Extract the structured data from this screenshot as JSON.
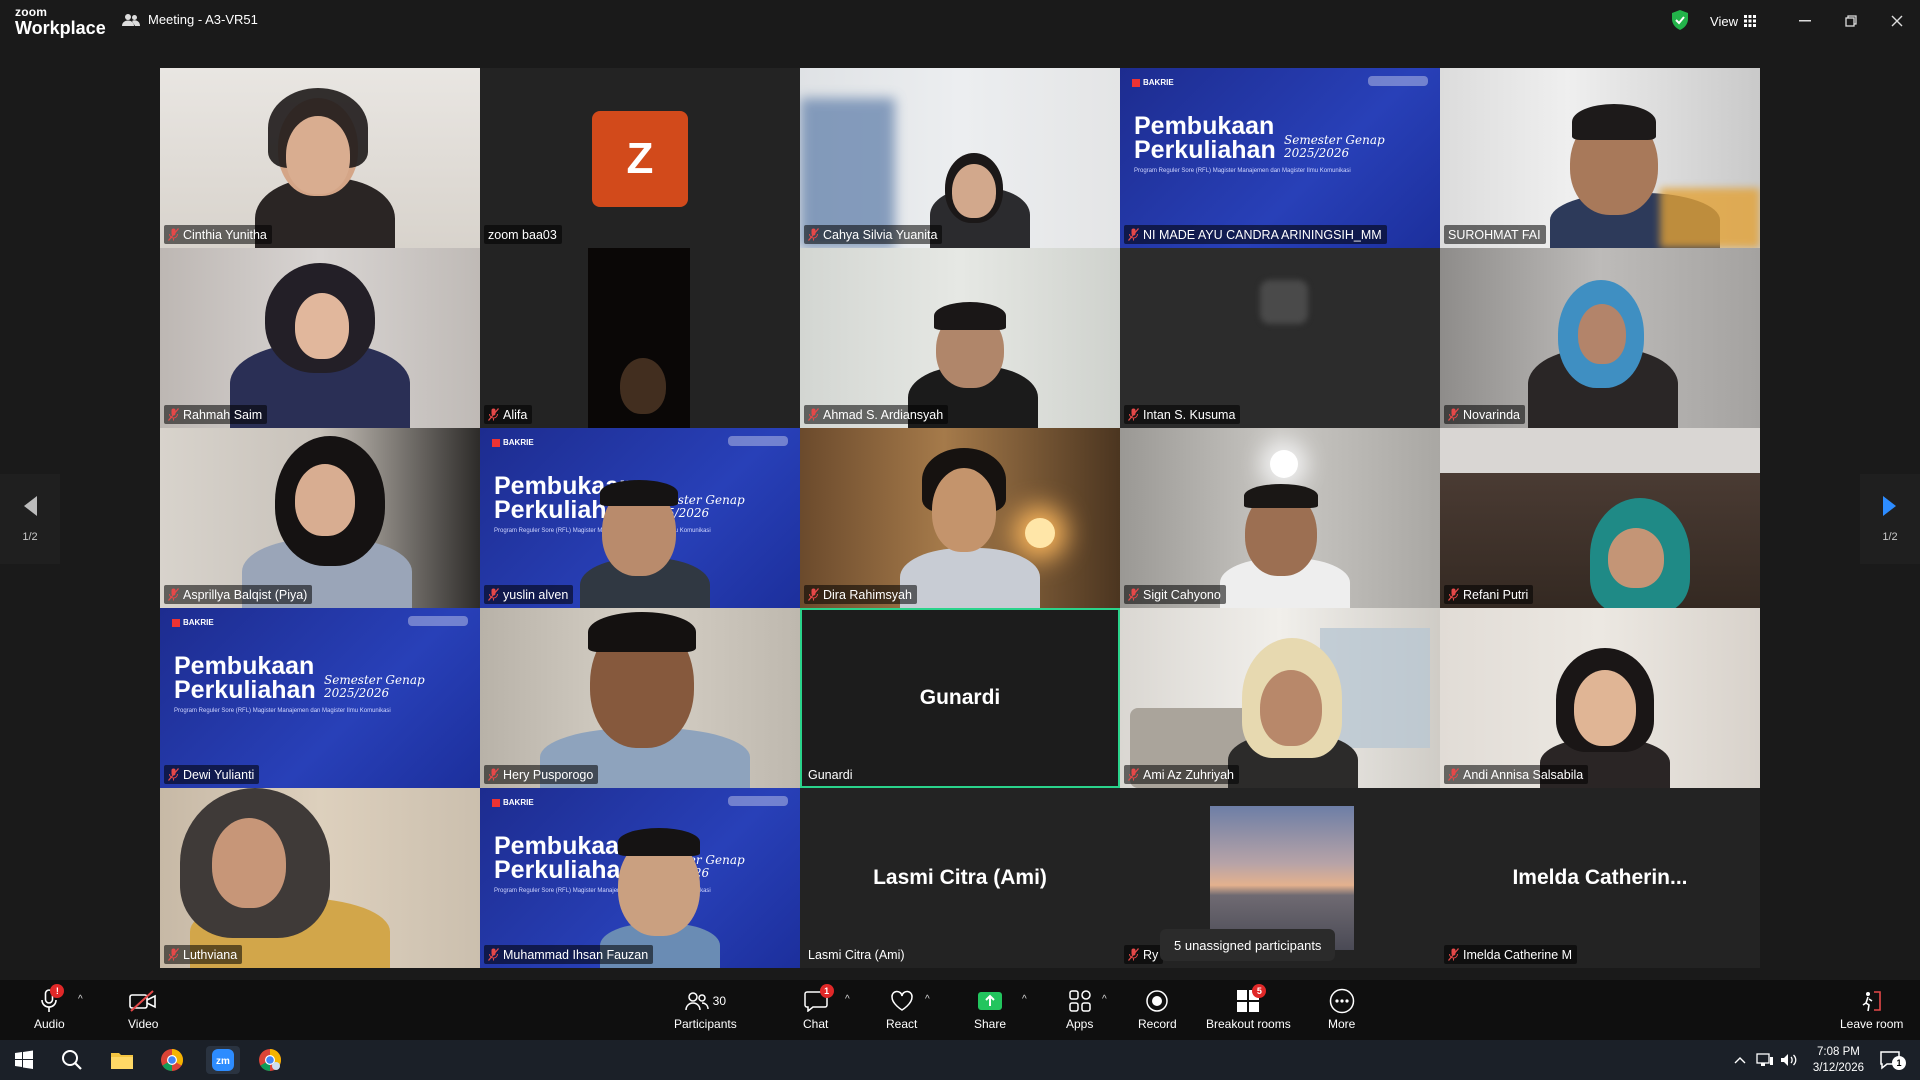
{
  "app": {
    "brand_top": "zoom",
    "brand_bottom": "Workplace",
    "meeting_title": "Meeting - A3-VR51",
    "view_label": "View"
  },
  "slide": {
    "brand": "BAKRIE",
    "title_line1": "Pembukaan",
    "title_line2": "Perkuliahan",
    "semester_line1": "Semester Genap",
    "semester_line2": "2025/2026",
    "subtitle": "Program Reguler Sore (RFL) Magister Manajemen dan Magister Ilmu Komunikasi"
  },
  "participants": [
    {
      "name": "Cinthia Yunitha"
    },
    {
      "name": "zoom baa03",
      "avatar": "Z"
    },
    {
      "name": "Cahya Silvia Yuanita"
    },
    {
      "name": "NI MADE AYU CANDRA ARININGSIH_MM"
    },
    {
      "name": "SUROHMAT FAI"
    },
    {
      "name": "Rahmah Saim"
    },
    {
      "name": "Alifa"
    },
    {
      "name": "Ahmad S. Ardiansyah"
    },
    {
      "name": "Intan S. Kusuma"
    },
    {
      "name": "Novarinda"
    },
    {
      "name": "Asprillya Balqist (Piya)"
    },
    {
      "name": "yuslin alven"
    },
    {
      "name": "Dira Rahimsyah"
    },
    {
      "name": "Sigit Cahyono"
    },
    {
      "name": "Refani Putri"
    },
    {
      "name": "Dewi Yulianti"
    },
    {
      "name": "Hery Pusporogo"
    },
    {
      "name": "Gunardi",
      "center": "Gunardi"
    },
    {
      "name": "Ami Az Zuhriyah"
    },
    {
      "name": "Andi Annisa Salsabila"
    },
    {
      "name": "Luthviana"
    },
    {
      "name": "Muhammad Ihsan Fauzan"
    },
    {
      "name": "Lasmi Citra (Ami)",
      "center": "Lasmi Citra (Ami)"
    },
    {
      "name": "Ry"
    },
    {
      "name": "Imelda Catherine M",
      "center": "Imelda  Catherin..."
    }
  ],
  "pager": {
    "left": "1/2",
    "right": "1/2"
  },
  "tooltip": "5 unassigned participants",
  "toolbar": {
    "audio": "Audio",
    "audio_badge": "!",
    "video": "Video",
    "participants": "Participants",
    "participants_count": "30",
    "chat": "Chat",
    "chat_badge": "1",
    "react": "React",
    "share": "Share",
    "apps": "Apps",
    "record": "Record",
    "breakout": "Breakout rooms",
    "breakout_badge": "5",
    "more": "More",
    "leave": "Leave room"
  },
  "taskbar": {
    "time": "7:08 PM",
    "date": "3/12/2026",
    "notifications": "1"
  },
  "colors": {
    "active_speaker": "#2ad38b",
    "badge": "#e02828",
    "share": "#22c55e",
    "avatar": "#d24a1b"
  }
}
